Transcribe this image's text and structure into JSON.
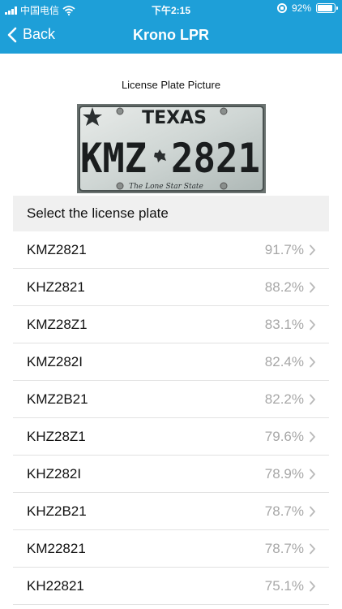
{
  "status": {
    "carrier": "中国电信",
    "time": "下午2:15",
    "battery": "92%",
    "battery_level": 0.92
  },
  "nav": {
    "back_label": "Back",
    "title": "Krono LPR"
  },
  "picture": {
    "label": "License Plate Picture",
    "state": "TEXAS",
    "plate_left": "KMZ",
    "plate_right": "2821",
    "slogan": "The Lone Star State"
  },
  "list": {
    "header": "Select the license plate",
    "items": [
      {
        "plate": "KMZ2821",
        "confidence": "91.7%"
      },
      {
        "plate": "KHZ2821",
        "confidence": "88.2%"
      },
      {
        "plate": "KMZ28Z1",
        "confidence": "83.1%"
      },
      {
        "plate": "KMZ282I",
        "confidence": "82.4%"
      },
      {
        "plate": "KMZ2B21",
        "confidence": "82.2%"
      },
      {
        "plate": "KHZ28Z1",
        "confidence": "79.6%"
      },
      {
        "plate": "KHZ282I",
        "confidence": "78.9%"
      },
      {
        "plate": "KHZ2B21",
        "confidence": "78.7%"
      },
      {
        "plate": "KM22821",
        "confidence": "78.7%"
      },
      {
        "plate": "KH22821",
        "confidence": "75.1%"
      }
    ]
  },
  "colors": {
    "header_bg": "#1e9fd8",
    "list_header_bg": "#f0f0f0",
    "confidence_text": "#a7a7a7"
  },
  "icons": [
    "signal-icon",
    "wifi-icon",
    "rotation-lock-icon",
    "battery-icon",
    "back-chevron-icon",
    "chevron-right-icon",
    "star-icon"
  ]
}
